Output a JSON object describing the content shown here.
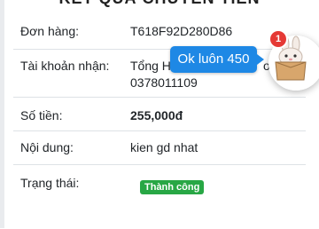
{
  "card": {
    "title": "KẾT QUẢ CHUYỂN TIỀN"
  },
  "rows": [
    {
      "label": "Đơn hàng:",
      "value": "T618F92D280D86"
    },
    {
      "label": "Tài khoản nhận:",
      "value": "Tổng H",
      "value_suffix": "ơ",
      "value_line2": "0378011109"
    },
    {
      "label": "Số tiền:",
      "value": "255,000đ"
    },
    {
      "label": "Nội dung:",
      "value": "kien gd nhat"
    },
    {
      "label": "Trạng thái:",
      "badge": "Thành công"
    }
  ],
  "chat_widget": {
    "message": "Ok luôn 450",
    "unread_count": "1",
    "avatar_icon": "bunny-in-box-icon"
  },
  "colors": {
    "badge": "#28a745",
    "tooltip": "#1e88e5",
    "notification": "#e53935"
  }
}
